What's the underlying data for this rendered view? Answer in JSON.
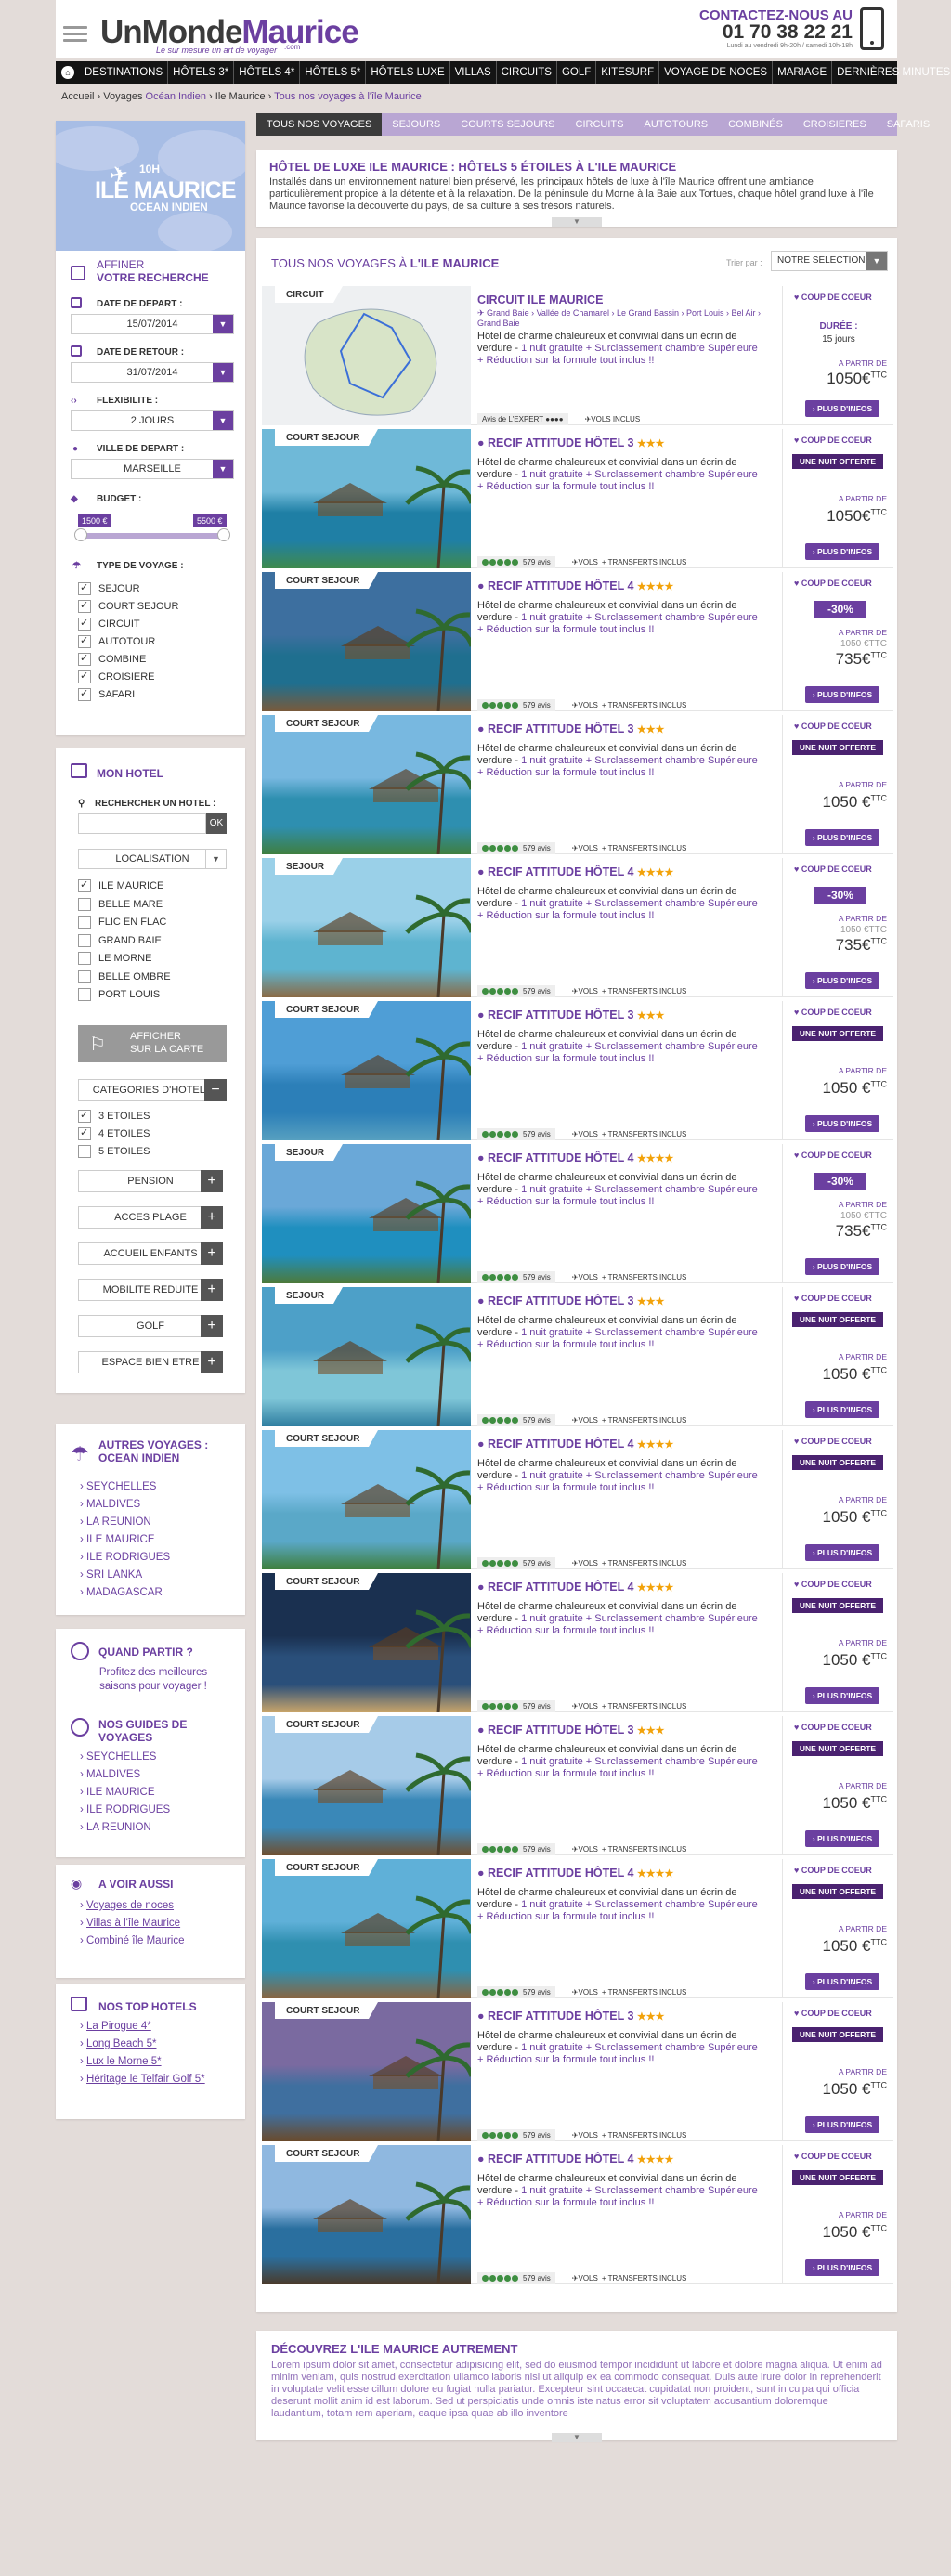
{
  "header": {
    "logo_part1": "UnMonde",
    "logo_part2": "Maurice",
    "logo_suffix": ".com",
    "tagline": "Le sur mesure un art de voyager",
    "contact_label": "CONTACTEZ-NOUS AU",
    "phone": "01 70 38 22 21",
    "hours": "Lundi au vendredi 9h-20h / samedi 10h-18h"
  },
  "nav": [
    "DESTINATIONS",
    "HÔTELS 3*",
    "HÔTELS 4*",
    "HÔTELS 5*",
    "HÔTELS LUXE",
    "VILLAS",
    "CIRCUITS",
    "GOLF",
    "KITESURF",
    "VOYAGE DE NOCES",
    "MARIAGE",
    "DERNIÈRES MINUTES"
  ],
  "breadcrumb": {
    "home": "Accueil",
    "sep": "›",
    "voyages": "Voyages",
    "region": "Océan Indien",
    "country": "Ile Maurice",
    "current": "Tous nos voyages à l'île Maurice"
  },
  "destination": {
    "flight": "10H",
    "name": "ILE MAURICE",
    "region": "OCEAN INDIEN"
  },
  "filters": {
    "title1": "AFFINER",
    "title2": "VOTRE RECHERCHE",
    "depart_label": "DATE DE DEPART :",
    "depart_value": "15/07/2014",
    "retour_label": "DATE DE RETOUR :",
    "retour_value": "31/07/2014",
    "flex_label": "FLEXIBILITE :",
    "flex_value": "2 JOURS",
    "ville_label": "VILLE DE DEPART :",
    "ville_value": "MARSEILLE",
    "budget_label": "BUDGET :",
    "budget_min": "1500 €",
    "budget_max": "5500 €",
    "type_label": "TYPE DE VOYAGE :",
    "types": [
      {
        "label": "SEJOUR",
        "checked": true
      },
      {
        "label": "COURT SEJOUR",
        "checked": true
      },
      {
        "label": "CIRCUIT",
        "checked": true
      },
      {
        "label": "AUTOTOUR",
        "checked": true
      },
      {
        "label": "COMBINE",
        "checked": true
      },
      {
        "label": "CROISIERE",
        "checked": true
      },
      {
        "label": "SAFARI",
        "checked": true
      }
    ]
  },
  "hotel": {
    "title": "MON HOTEL",
    "search_label": "RECHERCHER UN HOTEL :",
    "search_btn": "OK",
    "localisation": "LOCALISATION",
    "locations": [
      {
        "label": "ILE MAURICE",
        "checked": true
      },
      {
        "label": "BELLE MARE",
        "checked": false
      },
      {
        "label": "FLIC EN FLAC",
        "checked": false
      },
      {
        "label": "GRAND BAIE",
        "checked": false
      },
      {
        "label": "LE MORNE",
        "checked": false
      },
      {
        "label": "BELLE OMBRE",
        "checked": false
      },
      {
        "label": "PORT LOUIS",
        "checked": false
      }
    ],
    "map_btn1": "AFFICHER",
    "map_btn2": "SUR LA CARTE",
    "categories": "CATEGORIES D'HOTELS",
    "cat_items": [
      {
        "label": "3 ETOILES",
        "checked": true
      },
      {
        "label": "4 ETOILES",
        "checked": true
      },
      {
        "label": "5 ETOILES",
        "checked": false
      }
    ],
    "more": [
      "PENSION",
      "ACCES PLAGE",
      "ACCUEIL ENFANTS",
      "MOBILITE REDUITE",
      "GOLF",
      "ESPACE BIEN ETRE"
    ]
  },
  "others": {
    "title1": "AUTRES VOYAGES :",
    "title2": "OCEAN INDIEN",
    "items": [
      "SEYCHELLES",
      "MALDIVES",
      "LA REUNION",
      "ILE MAURICE",
      "ILE RODRIGUES",
      "SRI LANKA",
      "MADAGASCAR"
    ]
  },
  "quand": {
    "title": "QUAND PARTIR ?",
    "text": "Profitez des meilleures saisons pour voyager !"
  },
  "guides": {
    "title1": "NOS GUIDES DE",
    "title2": "VOYAGES",
    "items": [
      "SEYCHELLES",
      "MALDIVES",
      "ILE MAURICE",
      "ILE RODRIGUES",
      "LA REUNION"
    ]
  },
  "avoir": {
    "title": "A VOIR AUSSI",
    "items": [
      "Voyages de noces",
      "Villas à l'île Maurice",
      "Combiné île Maurice"
    ]
  },
  "top": {
    "title": "NOS TOP HOTELS",
    "items": [
      "La Pirogue 4*",
      "Long Beach 5*",
      "Lux le Morne 5*",
      "Héritage le Telfair Golf 5*"
    ]
  },
  "tabs": [
    "TOUS NOS VOYAGES",
    "SEJOURS",
    "COURTS SEJOURS",
    "CIRCUITS",
    "AUTOTOURS",
    "COMBINÉS",
    "CROISIERES",
    "SAFARIS"
  ],
  "intro": {
    "title": "HÔTEL DE LUXE ILE MAURICE : HÔTELS 5 ÉTOILES À L'ILE MAURICE",
    "text": "Installés dans un environnement naturel bien préservé, les principaux hôtels de luxe à l'île Maurice offrent une ambiance particulièrement propice à la détente et à la relaxation. De la péninsule du Morne à la Baie aux Tortues, chaque hôtel grand luxe à l'île Maurice favorise la découverte du pays, de sa culture à ses trésors naturels."
  },
  "list": {
    "title": "TOUS NOS VOYAGES À",
    "title_place": "L'ILE MAURICE",
    "sort_label": "Trier par :",
    "sort_value": "NOTRE SELECTION",
    "desc": "Hôtel de charme chaleureux et convivial dans un écrin de verdure -",
    "desc_promo": "1 nuit gratuite + Surclassement chambre Supérieure + Réduction sur la formule tout inclus !!",
    "avis": "579 avis",
    "vols": "VOLS",
    "transferts": "+ TRANSFERTS INCLUS",
    "coup": "COUP DE COEUR",
    "nuit": "UNE NUIT OFFERTE",
    "apartir": "A PARTIR DE",
    "ttc": "TTC",
    "plus": "› PLUS D'INFOS",
    "circuit": {
      "tag": "CIRCUIT",
      "title": "CIRCUIT ILE MAURICE",
      "route": "✈ Grand Baie › Vallée de Chamarel › Le Grand Bassin › Port Louis › Bel Air › Grand Baie",
      "expert": "Avis de L'EXPERT ●●●●",
      "vols": "VOLS INCLUS",
      "duree_label": "DURÉE :",
      "duree": "15 jours",
      "price": "1050€"
    },
    "offers": [
      {
        "tag": "COURT SEJOUR",
        "name": "RECIF ATTITUDE HÔTEL 3",
        "stars": "★★★",
        "badge": "nuit",
        "old": "",
        "price": "1050€"
      },
      {
        "tag": "COURT SEJOUR",
        "name": "RECIF ATTITUDE HÔTEL 4",
        "stars": "★★★★",
        "badge": "pct",
        "pct": "-30%",
        "old": "1050 €TTC",
        "price": "735€"
      },
      {
        "tag": "COURT SEJOUR",
        "name": "RECIF ATTITUDE HÔTEL 3",
        "stars": "★★★",
        "badge": "nuit",
        "old": "",
        "price": "1050 €"
      },
      {
        "tag": "SEJOUR",
        "name": "RECIF ATTITUDE HÔTEL 4",
        "stars": "★★★★",
        "badge": "pct",
        "pct": "-30%",
        "old": "1050 €TTC",
        "price": "735€"
      },
      {
        "tag": "COURT SEJOUR",
        "name": "RECIF ATTITUDE HÔTEL 3",
        "stars": "★★★",
        "badge": "nuit",
        "old": "",
        "price": "1050 €"
      },
      {
        "tag": "SEJOUR",
        "name": "RECIF ATTITUDE HÔTEL 4",
        "stars": "★★★★",
        "badge": "pct",
        "pct": "-30%",
        "old": "1050 €TTC",
        "price": "735€"
      },
      {
        "tag": "SEJOUR",
        "name": "RECIF ATTITUDE HÔTEL 3",
        "stars": "★★★",
        "badge": "nuit",
        "old": "",
        "price": "1050 €"
      },
      {
        "tag": "COURT SEJOUR",
        "name": "RECIF ATTITUDE HÔTEL 4",
        "stars": "★★★★",
        "badge": "nuit",
        "old": "",
        "price": "1050 €"
      },
      {
        "tag": "COURT SEJOUR",
        "name": "RECIF ATTITUDE HÔTEL 4",
        "stars": "★★★★",
        "badge": "nuit",
        "old": "",
        "price": "1050 €"
      },
      {
        "tag": "COURT SEJOUR",
        "name": "RECIF ATTITUDE HÔTEL 3",
        "stars": "★★★",
        "badge": "nuit",
        "old": "",
        "price": "1050 €"
      },
      {
        "tag": "COURT SEJOUR",
        "name": "RECIF ATTITUDE HÔTEL 4",
        "stars": "★★★★",
        "badge": "nuit",
        "old": "",
        "price": "1050 €"
      },
      {
        "tag": "COURT SEJOUR",
        "name": "RECIF ATTITUDE HÔTEL 3",
        "stars": "★★★",
        "badge": "nuit",
        "old": "",
        "price": "1050 €"
      },
      {
        "tag": "COURT SEJOUR",
        "name": "RECIF ATTITUDE HÔTEL 4",
        "stars": "★★★★",
        "badge": "nuit",
        "old": "",
        "price": "1050 €"
      }
    ]
  },
  "decouvrir": {
    "title": "DÉCOUVREZ L'ILE MAURICE AUTREMENT",
    "text": "Lorem ipsum dolor sit amet, consectetur adipisicing elit, sed do eiusmod tempor incididunt ut labore et dolore magna aliqua. Ut enim ad minim veniam, quis nostrud exercitation ullamco laboris nisi ut aliquip ex ea commodo consequat. Duis aute irure dolor in reprehenderit in voluptate velit esse cillum dolore eu fugiat nulla pariatur. Excepteur sint occaecat cupidatat non proident, sunt in culpa qui officia deserunt mollit anim id est laborum. Sed ut perspiciatis unde omnis iste natus error sit voluptatem accusantium doloremque laudantium, totam rem aperiam, eaque ipsa quae ab illo inventore"
  },
  "colors": {
    "accent": "#6b3fa0",
    "dark": "#141414",
    "light_purple": "#b9a6d3",
    "background": "#e3dcd9"
  }
}
